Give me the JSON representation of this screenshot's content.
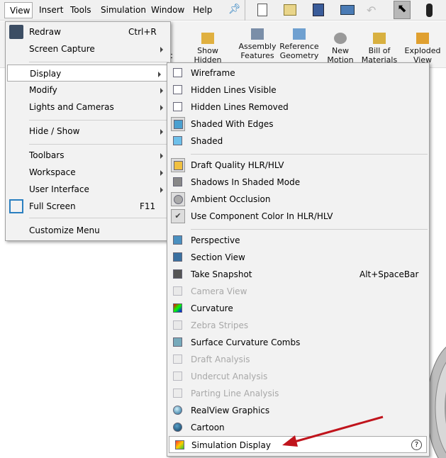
{
  "menubar": {
    "items": [
      "View",
      "Insert",
      "Tools",
      "Simulation",
      "Window",
      "Help"
    ],
    "pin_icon": "pin-icon"
  },
  "toolbar": {
    "icons": [
      "new-document-icon",
      "open-icon",
      "save-icon",
      "print-icon",
      "undo-icon",
      "select-icon",
      "traffic-light-icon"
    ]
  },
  "ribbon": {
    "partial": "nt",
    "commands": [
      {
        "label": "Show Hidden",
        "icon": "show-hidden-icon"
      },
      {
        "label": "Assembly Features",
        "icon": "assembly-features-icon"
      },
      {
        "label": "Reference Geometry",
        "icon": "reference-geometry-icon"
      },
      {
        "label": "New Motion",
        "icon": "new-motion-icon"
      },
      {
        "label": "Bill of Materials",
        "icon": "bom-icon"
      },
      {
        "label": "Exploded View",
        "icon": "exploded-view-icon"
      }
    ]
  },
  "view_menu": {
    "items": [
      {
        "label": "Redraw",
        "shortcut": "Ctrl+R",
        "icon": "redraw-icon"
      },
      {
        "label": "Screen Capture",
        "submenu": true
      },
      {
        "label": "Display",
        "submenu": true,
        "highlighted": true
      },
      {
        "label": "Modify",
        "submenu": true
      },
      {
        "label": "Lights and Cameras",
        "submenu": true
      },
      {
        "label": "Hide / Show",
        "submenu": true
      },
      {
        "label": "Toolbars",
        "submenu": true
      },
      {
        "label": "Workspace",
        "submenu": true
      },
      {
        "label": "User Interface",
        "submenu": true
      },
      {
        "label": "Full Screen",
        "shortcut": "F11",
        "icon": "full-screen-icon"
      },
      {
        "label": "Customize Menu"
      }
    ]
  },
  "display_menu": {
    "items": [
      {
        "label": "Wireframe",
        "icon": "wireframe-icon"
      },
      {
        "label": "Hidden Lines Visible",
        "icon": "hidden-lines-visible-icon"
      },
      {
        "label": "Hidden Lines Removed",
        "icon": "hidden-lines-removed-icon"
      },
      {
        "label": "Shaded With Edges",
        "icon": "shaded-with-edges-icon",
        "checked": true
      },
      {
        "label": "Shaded",
        "icon": "shaded-icon"
      },
      {
        "label": "Draft Quality HLR/HLV",
        "icon": "draft-quality-icon",
        "checked": true
      },
      {
        "label": "Shadows In Shaded Mode",
        "icon": "shadows-icon"
      },
      {
        "label": "Ambient Occlusion",
        "icon": "ambient-occlusion-icon",
        "checked": true
      },
      {
        "label": "Use Component Color In HLR/HLV",
        "icon": "checkmark-icon",
        "checked": true
      },
      {
        "label": "Perspective",
        "icon": "perspective-icon"
      },
      {
        "label": "Section View",
        "icon": "section-view-icon"
      },
      {
        "label": "Take Snapshot",
        "shortcut": "Alt+SpaceBar",
        "icon": "camera-icon"
      },
      {
        "label": "Camera View",
        "icon": "camera-view-icon",
        "disabled": true
      },
      {
        "label": "Curvature",
        "icon": "curvature-icon"
      },
      {
        "label": "Zebra Stripes",
        "icon": "zebra-stripes-icon",
        "disabled": true
      },
      {
        "label": "Surface Curvature Combs",
        "icon": "curvature-combs-icon"
      },
      {
        "label": "Draft Analysis",
        "icon": "draft-analysis-icon",
        "disabled": true
      },
      {
        "label": "Undercut Analysis",
        "icon": "undercut-analysis-icon",
        "disabled": true
      },
      {
        "label": "Parting Line Analysis",
        "icon": "parting-line-icon",
        "disabled": true
      },
      {
        "label": "RealView Graphics",
        "icon": "realview-icon"
      },
      {
        "label": "Cartoon",
        "icon": "cartoon-icon"
      },
      {
        "label": "Simulation Display",
        "icon": "simulation-display-icon",
        "highlighted": true,
        "help_icon": "help-icon"
      }
    ]
  },
  "colors": {
    "arrow": "#c0141c",
    "accent": "#2a7fc0"
  }
}
